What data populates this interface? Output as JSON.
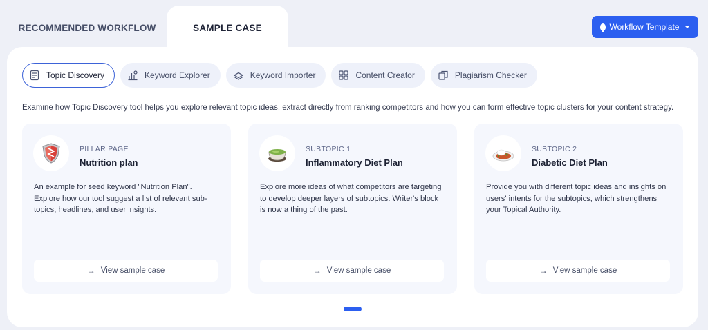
{
  "tabs": {
    "recommended": "RECOMMENDED WORKFLOW",
    "sample": "SAMPLE CASE"
  },
  "workflow_button": "Workflow Template",
  "tools": [
    {
      "label": "Topic Discovery",
      "icon": "topic-discovery-icon",
      "active": true
    },
    {
      "label": "Keyword Explorer",
      "icon": "keyword-explorer-icon",
      "active": false
    },
    {
      "label": "Keyword Importer",
      "icon": "keyword-importer-icon",
      "active": false
    },
    {
      "label": "Content Creator",
      "icon": "content-creator-icon",
      "active": false
    },
    {
      "label": "Plagiarism Checker",
      "icon": "plagiarism-checker-icon",
      "active": false
    }
  ],
  "description": "Examine how Topic Discovery tool helps you explore relevant topic ideas, extract directly from ranking competitors and how you can form effective topic clusters for your content strategy.",
  "cards": [
    {
      "kicker": "PILLAR PAGE",
      "title": "Nutrition plan",
      "body": "An example for seed keyword \"Nutrition Plan\". Explore how our tool suggest a list of relevant sub-topics, headlines, and user insights.",
      "button": "View sample case",
      "icon": "shield-icon"
    },
    {
      "kicker": "SUBTOPIC 1",
      "title": "Inflammatory Diet Plan",
      "body": "Explore more ideas of what competitors are targeting to develop deeper layers of subtopics. Writer's block is now a thing of the past.",
      "button": "View sample case",
      "icon": "soup-bowl-icon"
    },
    {
      "kicker": "SUBTOPIC 2",
      "title": "Diabetic Diet Plan",
      "body": "Provide you with different topic ideas and insights on users' intents for the subtopics, which strengthens your Topical Authority.",
      "button": "View sample case",
      "icon": "food-plate-icon"
    }
  ],
  "colors": {
    "accent": "#2c5ff0",
    "background": "#eef0f7",
    "card": "#f5f7fd",
    "pill": "#eef1fa"
  }
}
